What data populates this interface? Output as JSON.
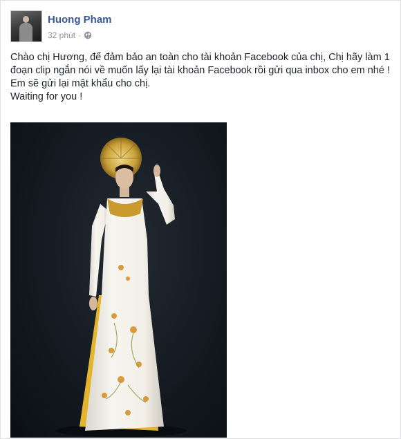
{
  "post": {
    "author": {
      "name": "Huong Pham"
    },
    "meta": {
      "timestamp": "32 phút",
      "separator": "·",
      "privacy_icon": "globe-icon"
    },
    "message": {
      "line1": "Chào chị Hương, để đảm bảo an toàn cho tài khoản Facebook của chị, Chị hãy làm 1 đoạn clip ngắn nói về muốn lấy lại tài khoản Facebook rồi gửi qua inbox cho em nhé ! Em sẽ gửi lại mật khẩu cho chị.",
      "line2": "Waiting for you !"
    },
    "photo": {
      "icon": "photo-image"
    }
  },
  "colors": {
    "author_link": "#365899",
    "meta_text": "#90949c",
    "body_text": "#1d2129",
    "photo_bg": "#141a21",
    "dress_white": "#f4f1ea",
    "dress_gold": "#e3b52c",
    "headdress_gold": "#caa23a"
  }
}
